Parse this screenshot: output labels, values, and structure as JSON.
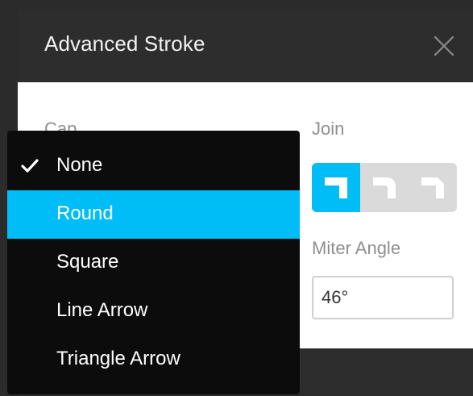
{
  "dialog": {
    "title": "Advanced Stroke"
  },
  "cap": {
    "label": "Cap",
    "selected": "None",
    "highlighted": "Round",
    "options": [
      "None",
      "Round",
      "Square",
      "Line Arrow",
      "Triangle Arrow"
    ]
  },
  "join": {
    "label": "Join",
    "options": [
      {
        "name": "miter",
        "icon": "miter-join-icon",
        "active": true
      },
      {
        "name": "round",
        "icon": "round-join-icon",
        "active": false
      },
      {
        "name": "bevel",
        "icon": "bevel-join-icon",
        "active": false
      }
    ]
  },
  "miter": {
    "label": "Miter Angle",
    "value": "46°"
  },
  "colors": {
    "accent": "#00bdf7",
    "dropdown_bg": "#0c0c0c",
    "header_bg": "#2d2d2d",
    "segment_bg": "#dadada"
  }
}
